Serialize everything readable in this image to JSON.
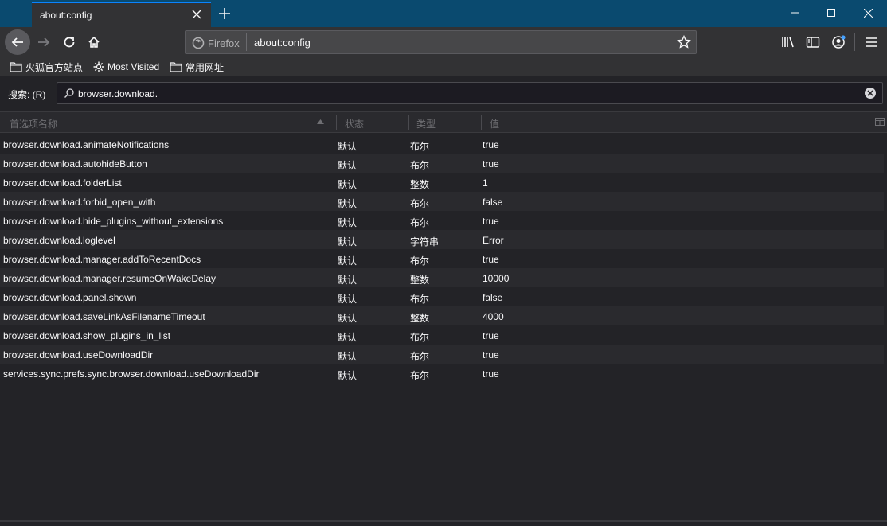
{
  "tab": {
    "title": "about:config"
  },
  "urlbar": {
    "identity_label": "Firefox",
    "url": "about:config"
  },
  "bookmarks": [
    {
      "label": "火狐官方站点",
      "icon": "folder-icon"
    },
    {
      "label": "Most Visited",
      "icon": "gear-icon"
    },
    {
      "label": "常用网址",
      "icon": "folder-icon"
    }
  ],
  "search": {
    "label": "搜索: (R)",
    "value": "browser.download."
  },
  "columns": [
    "首选项名称",
    "状态",
    "类型",
    "值"
  ],
  "rows": [
    {
      "name": "browser.download.animateNotifications",
      "status": "默认",
      "type": "布尔",
      "value": "true"
    },
    {
      "name": "browser.download.autohideButton",
      "status": "默认",
      "type": "布尔",
      "value": "true"
    },
    {
      "name": "browser.download.folderList",
      "status": "默认",
      "type": "整数",
      "value": "1"
    },
    {
      "name": "browser.download.forbid_open_with",
      "status": "默认",
      "type": "布尔",
      "value": "false"
    },
    {
      "name": "browser.download.hide_plugins_without_extensions",
      "status": "默认",
      "type": "布尔",
      "value": "true"
    },
    {
      "name": "browser.download.loglevel",
      "status": "默认",
      "type": "字符串",
      "value": "Error"
    },
    {
      "name": "browser.download.manager.addToRecentDocs",
      "status": "默认",
      "type": "布尔",
      "value": "true"
    },
    {
      "name": "browser.download.manager.resumeOnWakeDelay",
      "status": "默认",
      "type": "整数",
      "value": "10000"
    },
    {
      "name": "browser.download.panel.shown",
      "status": "默认",
      "type": "布尔",
      "value": "false"
    },
    {
      "name": "browser.download.saveLinkAsFilenameTimeout",
      "status": "默认",
      "type": "整数",
      "value": "4000"
    },
    {
      "name": "browser.download.show_plugins_in_list",
      "status": "默认",
      "type": "布尔",
      "value": "true"
    },
    {
      "name": "browser.download.useDownloadDir",
      "status": "默认",
      "type": "布尔",
      "value": "true"
    },
    {
      "name": "services.sync.prefs.sync.browser.download.useDownloadDir",
      "status": "默认",
      "type": "布尔",
      "value": "true"
    }
  ],
  "colors": {
    "accent": "#0a84ff",
    "titlebar": "#0a4a6f",
    "toolbar": "#323234",
    "content": "#232327"
  }
}
